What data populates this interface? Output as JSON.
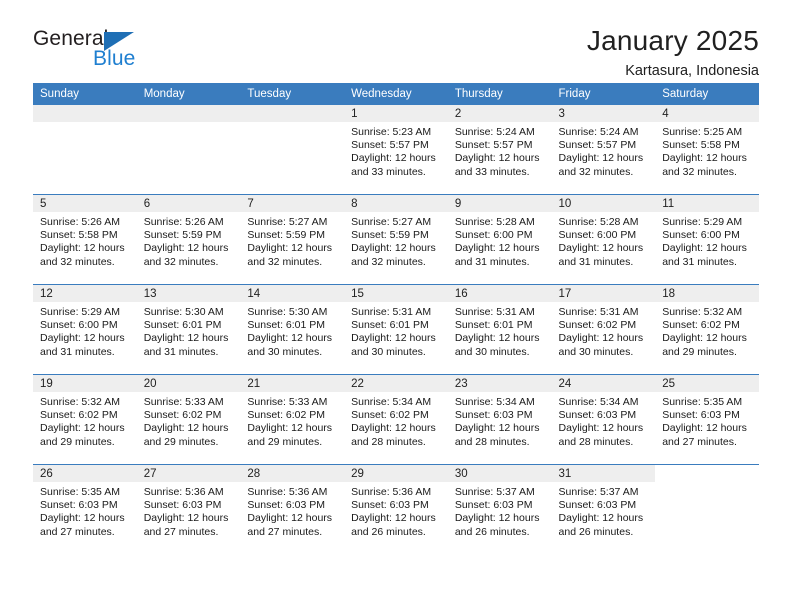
{
  "logo": {
    "word_one": "General",
    "word_two": "Blue",
    "triangle_icon": "blue-triangle-icon",
    "accent_dark": "#231f20",
    "accent_blue": "#1f7fd0"
  },
  "header": {
    "title": "January 2025",
    "subtitle": "Kartasura, Indonesia"
  },
  "theme": {
    "header_blue": "#3a7cbe",
    "daynum_gray": "#eeeeee"
  },
  "weekday_headers": [
    "Sunday",
    "Monday",
    "Tuesday",
    "Wednesday",
    "Thursday",
    "Friday",
    "Saturday"
  ],
  "labels": {
    "sunrise_prefix": "Sunrise:",
    "sunset_prefix": "Sunset:",
    "daylight_prefix": "Daylight:"
  },
  "weeks": [
    [
      {
        "day": "",
        "kind": "empty"
      },
      {
        "day": "",
        "kind": "empty"
      },
      {
        "day": "",
        "kind": "empty"
      },
      {
        "day": "1",
        "kind": "day",
        "sunrise": "Sunrise: 5:23 AM",
        "sunset": "Sunset: 5:57 PM",
        "daylight_line1": "Daylight: 12 hours",
        "daylight_line2": "and 33 minutes."
      },
      {
        "day": "2",
        "kind": "day",
        "sunrise": "Sunrise: 5:24 AM",
        "sunset": "Sunset: 5:57 PM",
        "daylight_line1": "Daylight: 12 hours",
        "daylight_line2": "and 33 minutes."
      },
      {
        "day": "3",
        "kind": "day",
        "sunrise": "Sunrise: 5:24 AM",
        "sunset": "Sunset: 5:57 PM",
        "daylight_line1": "Daylight: 12 hours",
        "daylight_line2": "and 32 minutes."
      },
      {
        "day": "4",
        "kind": "day",
        "sunrise": "Sunrise: 5:25 AM",
        "sunset": "Sunset: 5:58 PM",
        "daylight_line1": "Daylight: 12 hours",
        "daylight_line2": "and 32 minutes."
      }
    ],
    [
      {
        "day": "5",
        "kind": "day",
        "sunrise": "Sunrise: 5:26 AM",
        "sunset": "Sunset: 5:58 PM",
        "daylight_line1": "Daylight: 12 hours",
        "daylight_line2": "and 32 minutes."
      },
      {
        "day": "6",
        "kind": "day",
        "sunrise": "Sunrise: 5:26 AM",
        "sunset": "Sunset: 5:59 PM",
        "daylight_line1": "Daylight: 12 hours",
        "daylight_line2": "and 32 minutes."
      },
      {
        "day": "7",
        "kind": "day",
        "sunrise": "Sunrise: 5:27 AM",
        "sunset": "Sunset: 5:59 PM",
        "daylight_line1": "Daylight: 12 hours",
        "daylight_line2": "and 32 minutes."
      },
      {
        "day": "8",
        "kind": "day",
        "sunrise": "Sunrise: 5:27 AM",
        "sunset": "Sunset: 5:59 PM",
        "daylight_line1": "Daylight: 12 hours",
        "daylight_line2": "and 32 minutes."
      },
      {
        "day": "9",
        "kind": "day",
        "sunrise": "Sunrise: 5:28 AM",
        "sunset": "Sunset: 6:00 PM",
        "daylight_line1": "Daylight: 12 hours",
        "daylight_line2": "and 31 minutes."
      },
      {
        "day": "10",
        "kind": "day",
        "sunrise": "Sunrise: 5:28 AM",
        "sunset": "Sunset: 6:00 PM",
        "daylight_line1": "Daylight: 12 hours",
        "daylight_line2": "and 31 minutes."
      },
      {
        "day": "11",
        "kind": "day",
        "sunrise": "Sunrise: 5:29 AM",
        "sunset": "Sunset: 6:00 PM",
        "daylight_line1": "Daylight: 12 hours",
        "daylight_line2": "and 31 minutes."
      }
    ],
    [
      {
        "day": "12",
        "kind": "day",
        "sunrise": "Sunrise: 5:29 AM",
        "sunset": "Sunset: 6:00 PM",
        "daylight_line1": "Daylight: 12 hours",
        "daylight_line2": "and 31 minutes."
      },
      {
        "day": "13",
        "kind": "day",
        "sunrise": "Sunrise: 5:30 AM",
        "sunset": "Sunset: 6:01 PM",
        "daylight_line1": "Daylight: 12 hours",
        "daylight_line2": "and 31 minutes."
      },
      {
        "day": "14",
        "kind": "day",
        "sunrise": "Sunrise: 5:30 AM",
        "sunset": "Sunset: 6:01 PM",
        "daylight_line1": "Daylight: 12 hours",
        "daylight_line2": "and 30 minutes."
      },
      {
        "day": "15",
        "kind": "day",
        "sunrise": "Sunrise: 5:31 AM",
        "sunset": "Sunset: 6:01 PM",
        "daylight_line1": "Daylight: 12 hours",
        "daylight_line2": "and 30 minutes."
      },
      {
        "day": "16",
        "kind": "day",
        "sunrise": "Sunrise: 5:31 AM",
        "sunset": "Sunset: 6:01 PM",
        "daylight_line1": "Daylight: 12 hours",
        "daylight_line2": "and 30 minutes."
      },
      {
        "day": "17",
        "kind": "day",
        "sunrise": "Sunrise: 5:31 AM",
        "sunset": "Sunset: 6:02 PM",
        "daylight_line1": "Daylight: 12 hours",
        "daylight_line2": "and 30 minutes."
      },
      {
        "day": "18",
        "kind": "day",
        "sunrise": "Sunrise: 5:32 AM",
        "sunset": "Sunset: 6:02 PM",
        "daylight_line1": "Daylight: 12 hours",
        "daylight_line2": "and 29 minutes."
      }
    ],
    [
      {
        "day": "19",
        "kind": "day",
        "sunrise": "Sunrise: 5:32 AM",
        "sunset": "Sunset: 6:02 PM",
        "daylight_line1": "Daylight: 12 hours",
        "daylight_line2": "and 29 minutes."
      },
      {
        "day": "20",
        "kind": "day",
        "sunrise": "Sunrise: 5:33 AM",
        "sunset": "Sunset: 6:02 PM",
        "daylight_line1": "Daylight: 12 hours",
        "daylight_line2": "and 29 minutes."
      },
      {
        "day": "21",
        "kind": "day",
        "sunrise": "Sunrise: 5:33 AM",
        "sunset": "Sunset: 6:02 PM",
        "daylight_line1": "Daylight: 12 hours",
        "daylight_line2": "and 29 minutes."
      },
      {
        "day": "22",
        "kind": "day",
        "sunrise": "Sunrise: 5:34 AM",
        "sunset": "Sunset: 6:02 PM",
        "daylight_line1": "Daylight: 12 hours",
        "daylight_line2": "and 28 minutes."
      },
      {
        "day": "23",
        "kind": "day",
        "sunrise": "Sunrise: 5:34 AM",
        "sunset": "Sunset: 6:03 PM",
        "daylight_line1": "Daylight: 12 hours",
        "daylight_line2": "and 28 minutes."
      },
      {
        "day": "24",
        "kind": "day",
        "sunrise": "Sunrise: 5:34 AM",
        "sunset": "Sunset: 6:03 PM",
        "daylight_line1": "Daylight: 12 hours",
        "daylight_line2": "and 28 minutes."
      },
      {
        "day": "25",
        "kind": "day",
        "sunrise": "Sunrise: 5:35 AM",
        "sunset": "Sunset: 6:03 PM",
        "daylight_line1": "Daylight: 12 hours",
        "daylight_line2": "and 27 minutes."
      }
    ],
    [
      {
        "day": "26",
        "kind": "day",
        "sunrise": "Sunrise: 5:35 AM",
        "sunset": "Sunset: 6:03 PM",
        "daylight_line1": "Daylight: 12 hours",
        "daylight_line2": "and 27 minutes."
      },
      {
        "day": "27",
        "kind": "day",
        "sunrise": "Sunrise: 5:36 AM",
        "sunset": "Sunset: 6:03 PM",
        "daylight_line1": "Daylight: 12 hours",
        "daylight_line2": "and 27 minutes."
      },
      {
        "day": "28",
        "kind": "day",
        "sunrise": "Sunrise: 5:36 AM",
        "sunset": "Sunset: 6:03 PM",
        "daylight_line1": "Daylight: 12 hours",
        "daylight_line2": "and 27 minutes."
      },
      {
        "day": "29",
        "kind": "day",
        "sunrise": "Sunrise: 5:36 AM",
        "sunset": "Sunset: 6:03 PM",
        "daylight_line1": "Daylight: 12 hours",
        "daylight_line2": "and 26 minutes."
      },
      {
        "day": "30",
        "kind": "day",
        "sunrise": "Sunrise: 5:37 AM",
        "sunset": "Sunset: 6:03 PM",
        "daylight_line1": "Daylight: 12 hours",
        "daylight_line2": "and 26 minutes."
      },
      {
        "day": "31",
        "kind": "day",
        "sunrise": "Sunrise: 5:37 AM",
        "sunset": "Sunset: 6:03 PM",
        "daylight_line1": "Daylight: 12 hours",
        "daylight_line2": "and 26 minutes."
      },
      {
        "day": "",
        "kind": "blank"
      }
    ]
  ]
}
